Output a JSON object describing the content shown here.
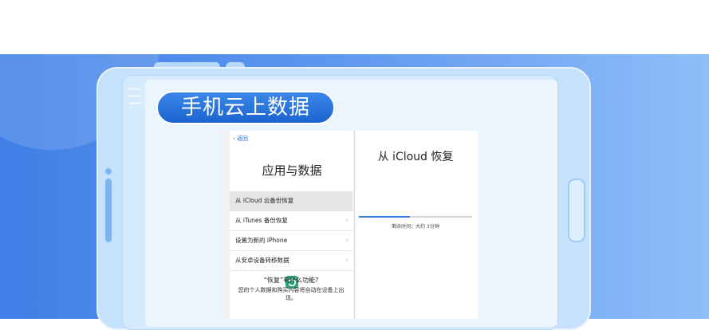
{
  "banner": {
    "title": "手机云上数据"
  },
  "left_screen": {
    "back_label": "返回",
    "icon": "restore-icon",
    "heading": "应用与数据",
    "options": [
      {
        "label": "从 iCloud 云备份恢复",
        "selected": true
      },
      {
        "label": "从 iTunes 备份恢复",
        "selected": false
      },
      {
        "label": "设置为新的 iPhone",
        "selected": false
      },
      {
        "label": "从安卓设备转移数据",
        "selected": false
      }
    ],
    "faq_title": "“恢复”有什么功能?",
    "faq_body": "您的个人数据和购买内容将自动在设备上出现。"
  },
  "right_screen": {
    "title": "从 iCloud 恢复",
    "progress": 0.45,
    "remaining_label": "剩余时间：大约 3分钟"
  },
  "colors": {
    "accent": "#3b7ae0",
    "banner_pill": "#1c64d0",
    "background_blue": "#3f7fe6"
  }
}
